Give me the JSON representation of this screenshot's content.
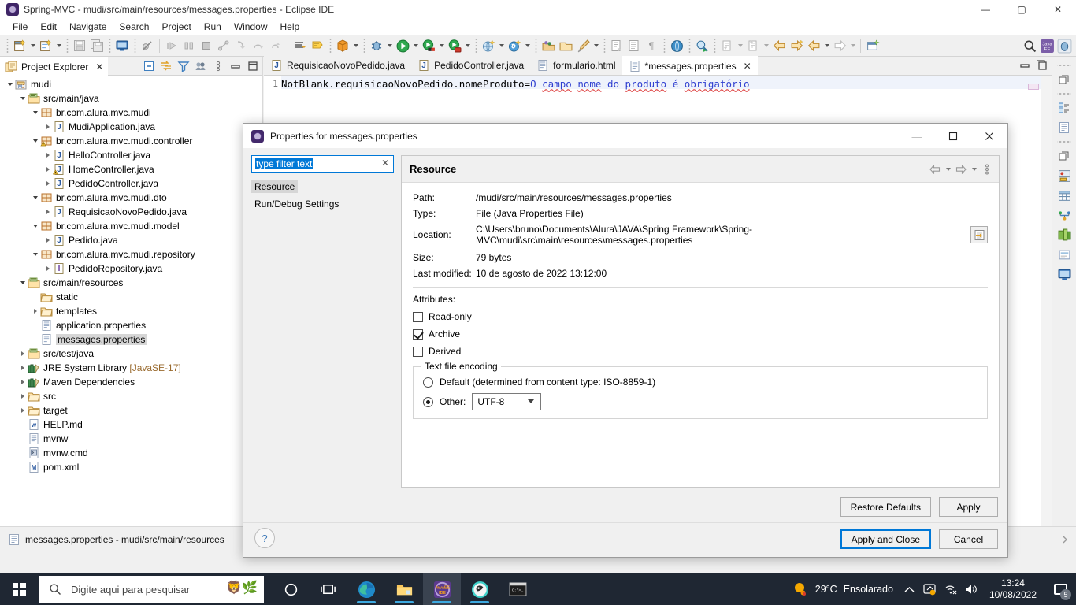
{
  "window": {
    "title": "Spring-MVC - mudi/src/main/resources/messages.properties - Eclipse IDE",
    "icon": "eclipse-icon",
    "minimize": "—",
    "maximize": "▢",
    "close": "✕"
  },
  "menubar": {
    "items": [
      "File",
      "Edit",
      "Navigate",
      "Search",
      "Project",
      "Run",
      "Window",
      "Help"
    ]
  },
  "explorer": {
    "tab_label": "Project Explorer",
    "tab_close": "✕",
    "tools": [
      "collapse-all-icon",
      "link-with-editor-icon",
      "view-menu-filter-icon",
      "focus-on-active-task-icon",
      "view-menu-icon",
      "minimize-icon",
      "maximize-icon"
    ],
    "tree": [
      {
        "label": "mudi",
        "indent": 0,
        "twist": "open",
        "icon": "project-icon",
        "selected": false
      },
      {
        "label": "src/main/java",
        "indent": 1,
        "twist": "open",
        "icon": "source-folder-icon",
        "selected": false
      },
      {
        "label": "br.com.alura.mvc.mudi",
        "indent": 2,
        "twist": "open",
        "icon": "package-icon",
        "selected": false
      },
      {
        "label": "MudiApplication.java",
        "indent": 3,
        "twist": "closed",
        "icon": "java-file-icon",
        "selected": false
      },
      {
        "label": "br.com.alura.mvc.mudi.controller",
        "indent": 2,
        "twist": "open",
        "icon": "package-warning-icon",
        "selected": false
      },
      {
        "label": "HelloController.java",
        "indent": 3,
        "twist": "closed",
        "icon": "java-file-icon",
        "selected": false
      },
      {
        "label": "HomeController.java",
        "indent": 3,
        "twist": "closed",
        "icon": "java-file-warning-icon",
        "selected": false
      },
      {
        "label": "PedidoController.java",
        "indent": 3,
        "twist": "closed",
        "icon": "java-file-icon",
        "selected": false
      },
      {
        "label": "br.com.alura.mvc.mudi.dto",
        "indent": 2,
        "twist": "open",
        "icon": "package-icon",
        "selected": false
      },
      {
        "label": "RequisicaoNovoPedido.java",
        "indent": 3,
        "twist": "closed",
        "icon": "java-file-icon",
        "selected": false
      },
      {
        "label": "br.com.alura.mvc.mudi.model",
        "indent": 2,
        "twist": "open",
        "icon": "package-icon",
        "selected": false
      },
      {
        "label": "Pedido.java",
        "indent": 3,
        "twist": "closed",
        "icon": "java-file-icon",
        "selected": false
      },
      {
        "label": "br.com.alura.mvc.mudi.repository",
        "indent": 2,
        "twist": "open",
        "icon": "package-icon",
        "selected": false
      },
      {
        "label": "PedidoRepository.java",
        "indent": 3,
        "twist": "closed",
        "icon": "interface-file-icon",
        "selected": false
      },
      {
        "label": "src/main/resources",
        "indent": 1,
        "twist": "open",
        "icon": "source-folder-icon",
        "selected": false
      },
      {
        "label": "static",
        "indent": 2,
        "twist": "none",
        "icon": "folder-icon",
        "selected": false
      },
      {
        "label": "templates",
        "indent": 2,
        "twist": "closed",
        "icon": "folder-icon",
        "selected": false
      },
      {
        "label": "application.properties",
        "indent": 2,
        "twist": "none",
        "icon": "properties-file-icon",
        "selected": false
      },
      {
        "label": "messages.properties",
        "indent": 2,
        "twist": "none",
        "icon": "properties-file-icon",
        "selected": true
      },
      {
        "label": "src/test/java",
        "indent": 1,
        "twist": "closed",
        "icon": "source-folder-icon",
        "selected": false
      },
      {
        "label": "JRE System Library",
        "suffix": " [JavaSE-17]",
        "indent": 1,
        "twist": "closed",
        "icon": "library-icon",
        "selected": false
      },
      {
        "label": "Maven Dependencies",
        "indent": 1,
        "twist": "closed",
        "icon": "library-icon",
        "selected": false
      },
      {
        "label": "src",
        "indent": 1,
        "twist": "closed",
        "icon": "folder-icon",
        "selected": false
      },
      {
        "label": "target",
        "indent": 1,
        "twist": "closed",
        "icon": "folder-icon",
        "selected": false
      },
      {
        "label": "HELP.md",
        "indent": 1,
        "twist": "none",
        "icon": "markdown-file-icon",
        "selected": false
      },
      {
        "label": "mvnw",
        "indent": 1,
        "twist": "none",
        "icon": "file-icon",
        "selected": false
      },
      {
        "label": "mvnw.cmd",
        "indent": 1,
        "twist": "none",
        "icon": "cmd-file-icon",
        "selected": false
      },
      {
        "label": "pom.xml",
        "indent": 1,
        "twist": "none",
        "icon": "maven-file-icon",
        "selected": false
      }
    ]
  },
  "editor": {
    "tabs": [
      {
        "label": "RequisicaoNovoPedido.java",
        "icon": "java-file-icon",
        "active": false,
        "closable": false
      },
      {
        "label": "PedidoController.java",
        "icon": "java-file-icon",
        "active": false,
        "closable": false
      },
      {
        "label": "formulario.html",
        "icon": "html-file-icon",
        "active": false,
        "closable": false
      },
      {
        "label": "*messages.properties",
        "icon": "properties-file-icon",
        "active": true,
        "closable": true
      }
    ],
    "tab_close": "✕",
    "line_number": "1",
    "code_key": "NotBlank.requisicaoNovoPedido.nomeProduto=",
    "code_value": "O campo nome do produto é obrigatório",
    "tools": [
      "minimize-icon",
      "maximize-icon"
    ]
  },
  "statusbar": {
    "icon": "properties-file-icon",
    "text": "messages.properties - mudi/src/main/resources"
  },
  "dialog": {
    "title": "Properties for messages.properties",
    "icon": "eclipse-icon",
    "minimize": "—",
    "maximize": "▢",
    "close": "✕",
    "filter": {
      "value": "type filter text",
      "placeholder": "type filter text",
      "clear": "✕"
    },
    "nav_items": [
      {
        "label": "Resource",
        "selected": true
      },
      {
        "label": "Run/Debug Settings",
        "selected": false
      }
    ],
    "page": {
      "heading": "Resource",
      "nav_back": "⇦",
      "nav_forward": "⇨",
      "menu": "⋮",
      "properties": [
        {
          "label": "Path:",
          "value": "/mudi/src/main/resources/messages.properties"
        },
        {
          "label": "Type:",
          "value": "File  (Java Properties File)"
        },
        {
          "label": "Location:",
          "value": "C:\\Users\\bruno\\Documents\\Alura\\JAVA\\Spring Framework\\Spring-MVC\\mudi\\src\\main\\resources\\messages.properties"
        },
        {
          "label": "Size:",
          "value": "79  bytes"
        },
        {
          "label": "Last modified:",
          "value": "10 de agosto de 2022 13:12:00"
        }
      ],
      "location_button_icon": "resolve-path-icon",
      "attributes_label": "Attributes:",
      "checkboxes": [
        {
          "label": "Read-only",
          "checked": false
        },
        {
          "label": "Archive",
          "checked": true
        },
        {
          "label": "Derived",
          "checked": false
        }
      ],
      "encoding": {
        "legend": "Text file encoding",
        "default_label": "Default (determined from content type: ISO-8859-1)",
        "default_selected": false,
        "other_label": "Other:",
        "other_selected": true,
        "other_value": "UTF-8"
      }
    },
    "buttons": {
      "restore_defaults": "Restore Defaults",
      "apply": "Apply",
      "apply_and_close": "Apply and Close",
      "cancel": "Cancel",
      "help": "?"
    }
  },
  "taskbar": {
    "start_icon": "windows-logo-icon",
    "search_placeholder": "Digite aqui para pesquisar",
    "search_icon": "search-icon",
    "apps": [
      {
        "name": "cortana-icon",
        "running": false,
        "active": false
      },
      {
        "name": "task-view-icon",
        "running": false,
        "active": false
      },
      {
        "name": "microsoft-edge-icon",
        "running": true,
        "active": false
      },
      {
        "name": "file-explorer-icon",
        "running": true,
        "active": false
      },
      {
        "name": "eclipse-ide-icon",
        "running": true,
        "active": true
      },
      {
        "name": "browser-icon",
        "running": true,
        "active": false
      },
      {
        "name": "terminal-icon",
        "running": false,
        "active": false
      }
    ],
    "weather": {
      "icon": "sunny-icon",
      "temp": "29°C",
      "condition": "Ensolarado"
    },
    "tray": {
      "chevron": "︿",
      "icons": [
        "onedrive-icon",
        "network-icon",
        "volume-icon"
      ]
    },
    "clock": {
      "time": "13:24",
      "date": "10/08/2022"
    },
    "notifications": {
      "icon": "notification-icon",
      "count": "5"
    }
  },
  "colors": {
    "accent": "#0078d7",
    "taskbar_bg": "#1f2733",
    "code_value": "#2f3fd0",
    "selection": "#d6d6d6"
  }
}
